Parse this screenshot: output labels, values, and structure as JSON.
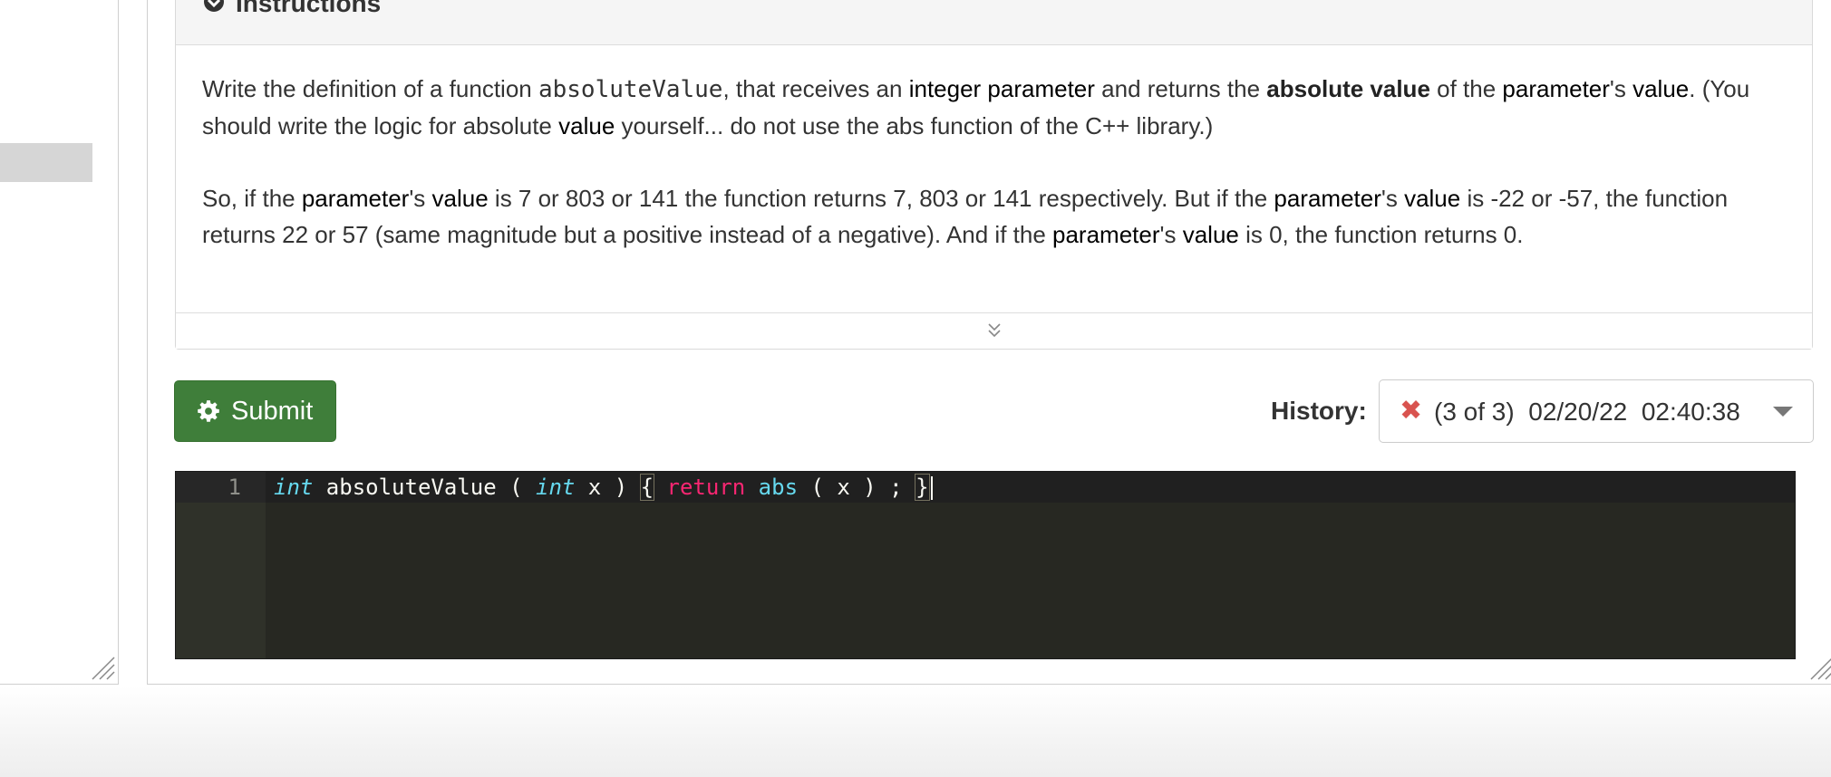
{
  "instructions": {
    "title": "Instructions",
    "p1": {
      "t1": "Write the definition of a function ",
      "func_name": "absoluteValue",
      "t2": ", that receives an ",
      "kw_integer_parameter": "integer parameter",
      "t3": " and returns the ",
      "strong_absolute_value": "absolute value",
      "t4": " of the ",
      "kw_parameter": "parameter",
      "t5": "'s ",
      "kw_value": "value",
      "t6": ". (You should write the logic for absolute ",
      "kw_value2": "value",
      "t7": " yourself... do not use the abs function of the C++ library.)"
    },
    "p2": {
      "t1": "So, if the ",
      "kw_parameter": "parameter",
      "t2": "'s ",
      "kw_value": "value",
      "t3": " is 7 or 803 or 141 the function returns 7, 803 or 141 respectively. But if the ",
      "kw_parameter2": "parameter",
      "t4": "'s ",
      "kw_value2": "value",
      "t5": " is -22 or -57, the function returns 22 or 57 (same magnitude but a positive instead of a negative). And if the ",
      "kw_parameter3": "parameter",
      "t6": "'s ",
      "kw_value3": "value",
      "t7": " is 0, the function returns 0."
    }
  },
  "toolbar": {
    "submit_label": "Submit"
  },
  "history": {
    "label": "History:",
    "selected": "(3 of 3)  02/20/22  02:40:38",
    "status_icon": "x-icon",
    "status_color": "#d9534f"
  },
  "editor": {
    "line_number": "1",
    "tokens": {
      "t_int1": "int",
      "t_fn": " absoluteValue ( ",
      "t_int2": "int",
      "t_x": " x ) ",
      "t_lbrace": "{",
      "t_sp1": " ",
      "t_return": "return",
      "t_sp2": " ",
      "t_abs": "abs",
      "t_rest": " ( x ) ; ",
      "t_rbrace": "}"
    }
  },
  "colors": {
    "submit_bg": "#3f7e3a",
    "editor_bg": "#272822",
    "keyword": "#f92672",
    "type": "#66d9ef"
  }
}
